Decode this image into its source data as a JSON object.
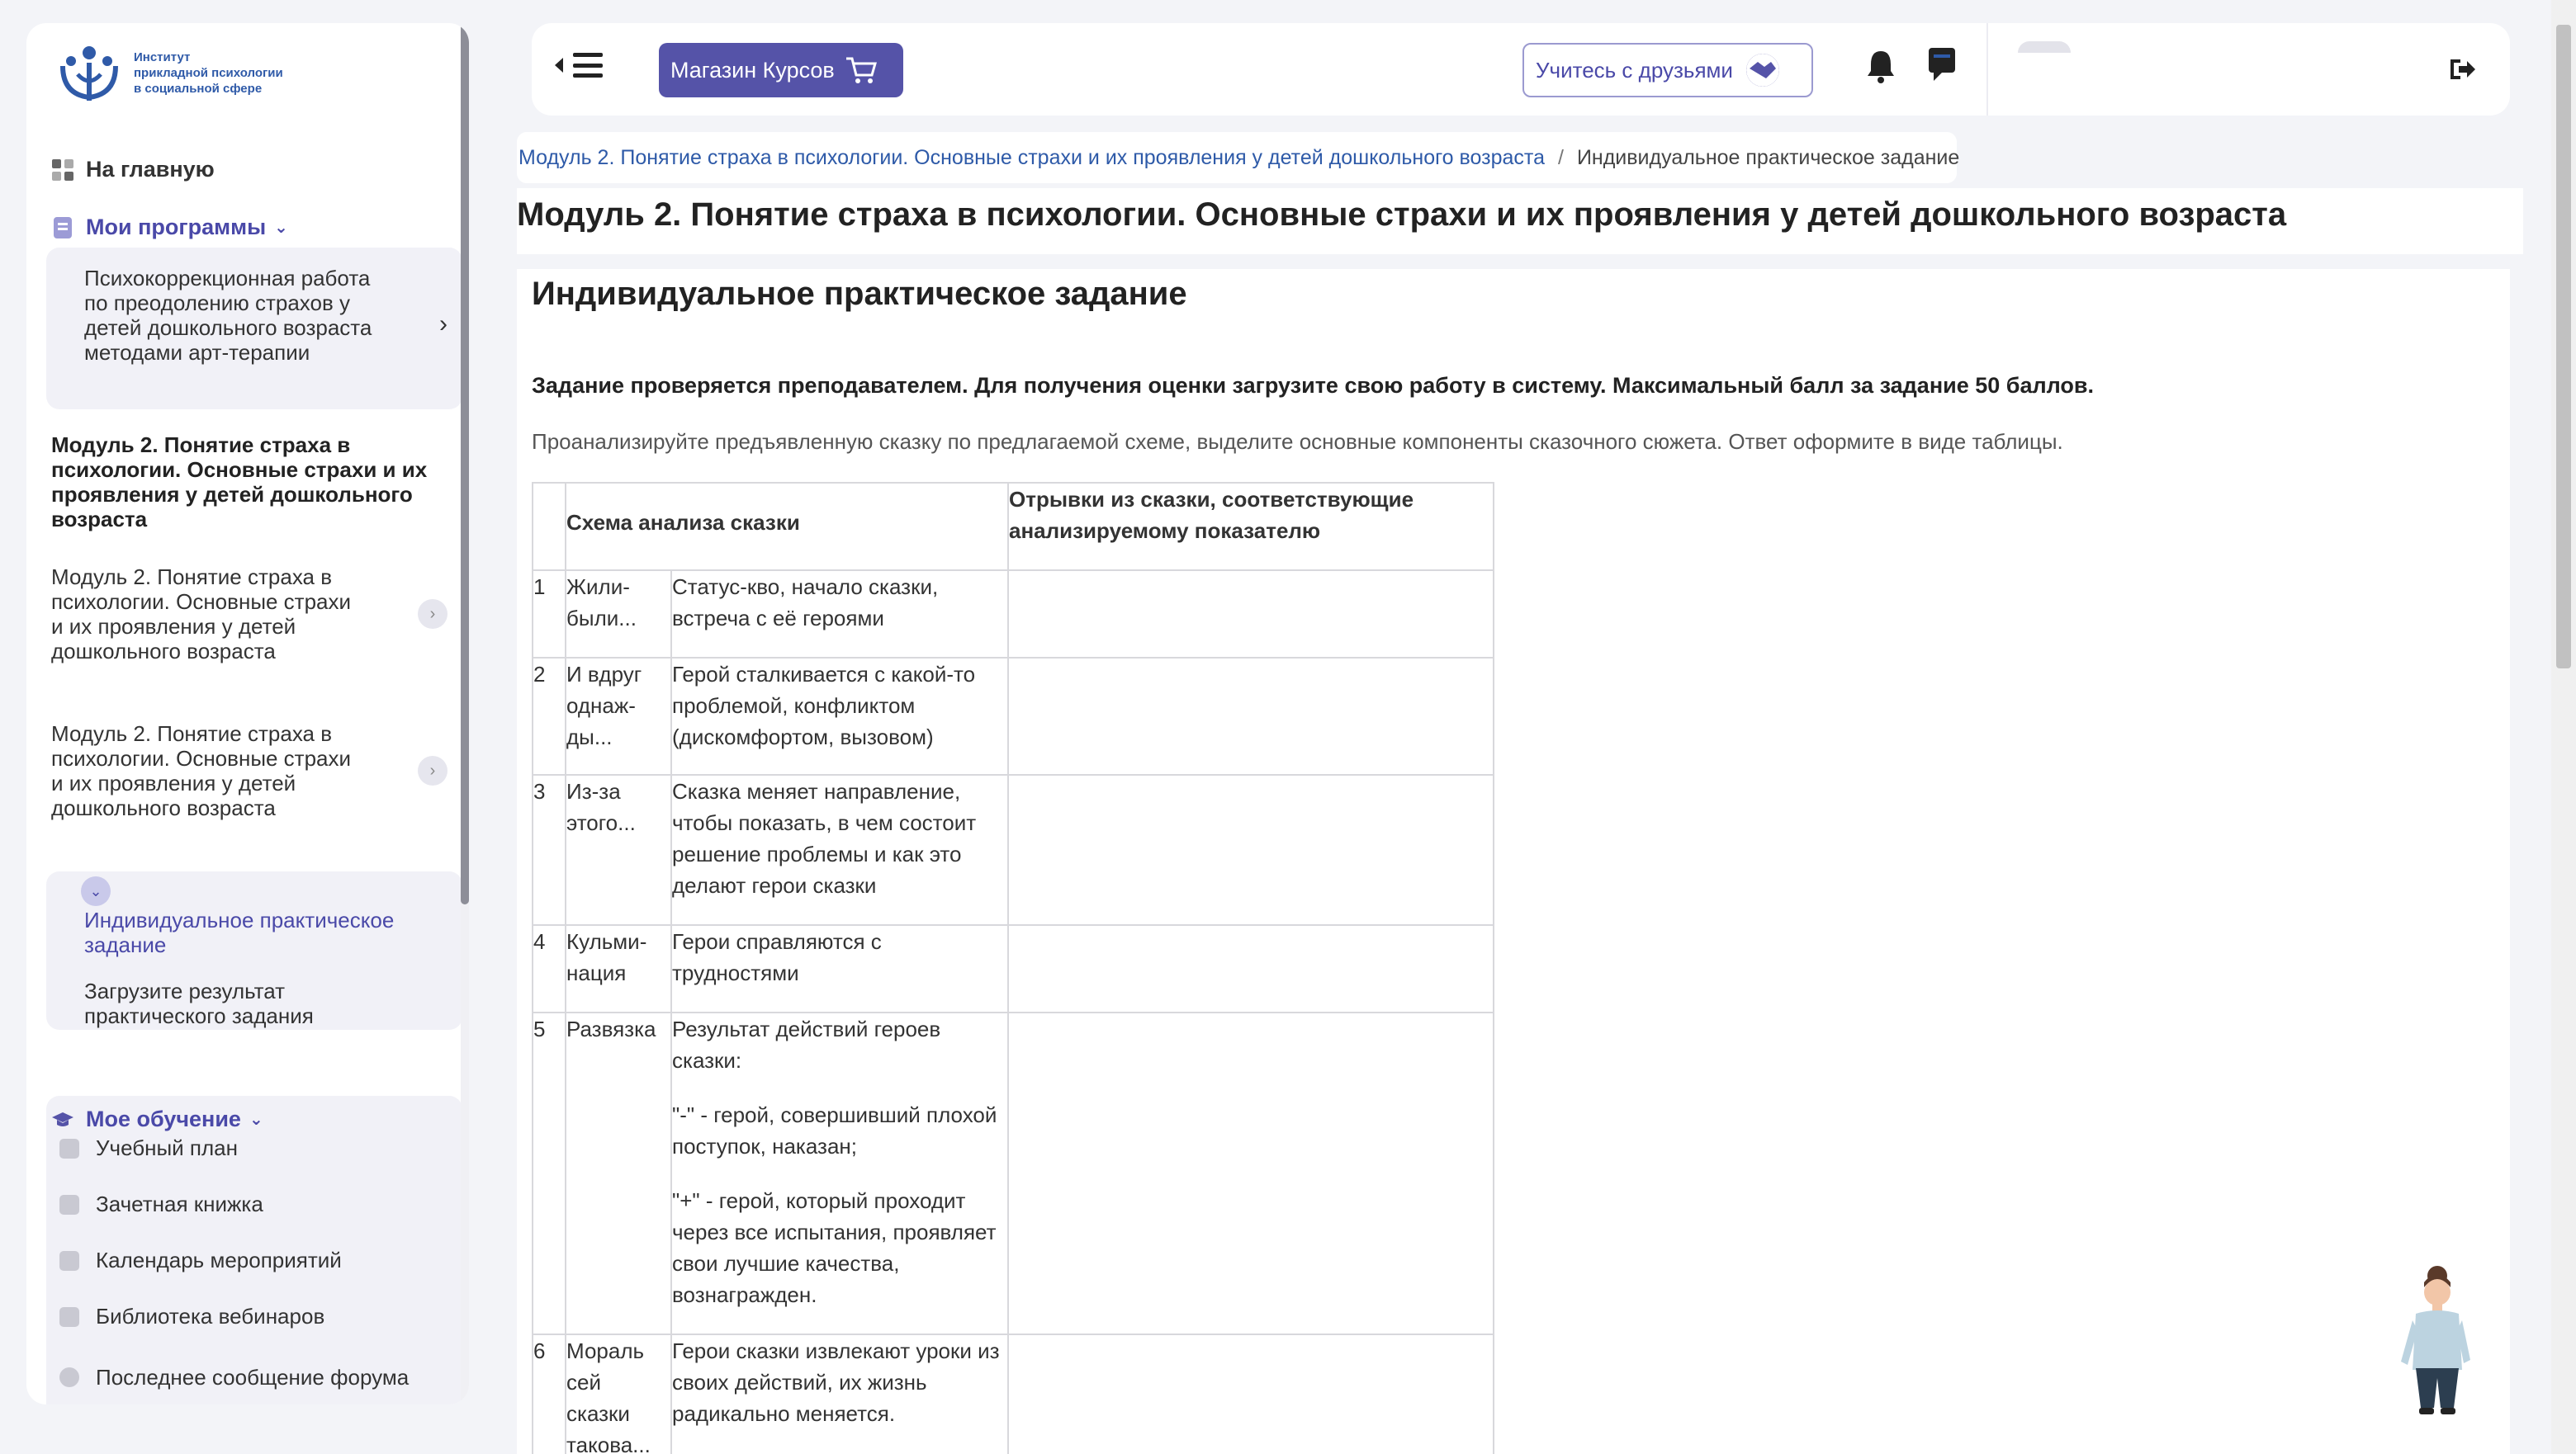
{
  "logo": {
    "lines": [
      "Институт",
      "прикладной психологии",
      "в социальной сфере"
    ]
  },
  "sidebar": {
    "home_label": "На главную",
    "programs_label": "Мои программы",
    "program_card": "Психокоррекционная работа по преодолению страхов у детей дошкольного возраста методами арт-терапии",
    "module_active": "Модуль 2. Понятие страха в психологии. Основные страхи и их проявления у детей дошкольного возраста",
    "modules": [
      {
        "label": "Модуль 2. Понятие страха в психологии. Основные страхи и их проявления у детей дошкольного возраста"
      },
      {
        "label": "Модуль 2. Понятие страха в психологии. Основные страхи и их проявления у детей дошкольного возраста"
      }
    ],
    "sub_items": [
      {
        "label": "Индивидуальное практическое задание"
      },
      {
        "label": "Загрузите результат практического задания"
      }
    ],
    "learning_label": "Мое обучение",
    "learning_items": [
      {
        "label": "Учебный план"
      },
      {
        "label": "Зачетная книжка"
      },
      {
        "label": "Календарь мероприятий"
      },
      {
        "label": "Библиотека вебинаров"
      },
      {
        "label": "Последнее сообщение форума"
      }
    ]
  },
  "topbar": {
    "shop_label": "Магазин Курсов",
    "friends_label": "Учитесь с друзьями"
  },
  "breadcrumb": {
    "link": "Модуль 2. Понятие страха в психологии. Основные страхи и их проявления у детей дошкольного возраста",
    "separator": "/",
    "current": "Индивидуальное практическое задание"
  },
  "page_title": "Модуль 2. Понятие страха в психологии. Основные страхи и их проявления у детей дошкольного возраста",
  "task": {
    "title": "Индивидуальное практическое задание",
    "note": "Задание проверяется преподавателем. Для получения оценки загрузите свою работу в систему. Максимальный балл за задание 50 баллов.",
    "description": "Проанализируйте предъявленную сказку по предлагаемой схеме, выделите основные компоненты сказочного сюжета. Ответ оформите в виде таблицы.",
    "table": {
      "header_scheme": "Схема анализа сказки",
      "header_excerpts": "Отрывки из сказки, соответствующие анализируемому показателю",
      "rows": [
        {
          "num": "1",
          "stage": "Жили-были...",
          "desc": [
            "Статус-кво, начало сказки, встреча с её героями"
          ]
        },
        {
          "num": "2",
          "stage": "И вдруг однаж-ды...",
          "desc": [
            "Герой сталкивается с какой-то проблемой, конфликтом (дискомфортом, вызовом)"
          ]
        },
        {
          "num": "3",
          "stage": "Из-за этого...",
          "desc": [
            "Сказка меняет направление, чтобы показать, в чем состоит решение проблемы и как это делают герои сказки"
          ]
        },
        {
          "num": "4",
          "stage": "Кульми-нация",
          "desc": [
            "Герои справляются с трудностями"
          ]
        },
        {
          "num": "5",
          "stage": "Развязка",
          "desc": [
            "Результат действий героев сказки:",
            "\"-\" - герой, совершивший плохой поступок, наказан;",
            "\"+\" - герой, который проходит через все испытания, проявляет свои лучшие качества, вознагражден."
          ]
        },
        {
          "num": "6",
          "stage": "Мораль сей сказки такова...",
          "desc": [
            "Герои сказки извлекают уроки из своих действий, их жизнь радикально меняется."
          ]
        }
      ]
    }
  },
  "colors": {
    "accent": "#5553a8",
    "link": "#2e5aa8",
    "background": "#f3f4f8"
  }
}
